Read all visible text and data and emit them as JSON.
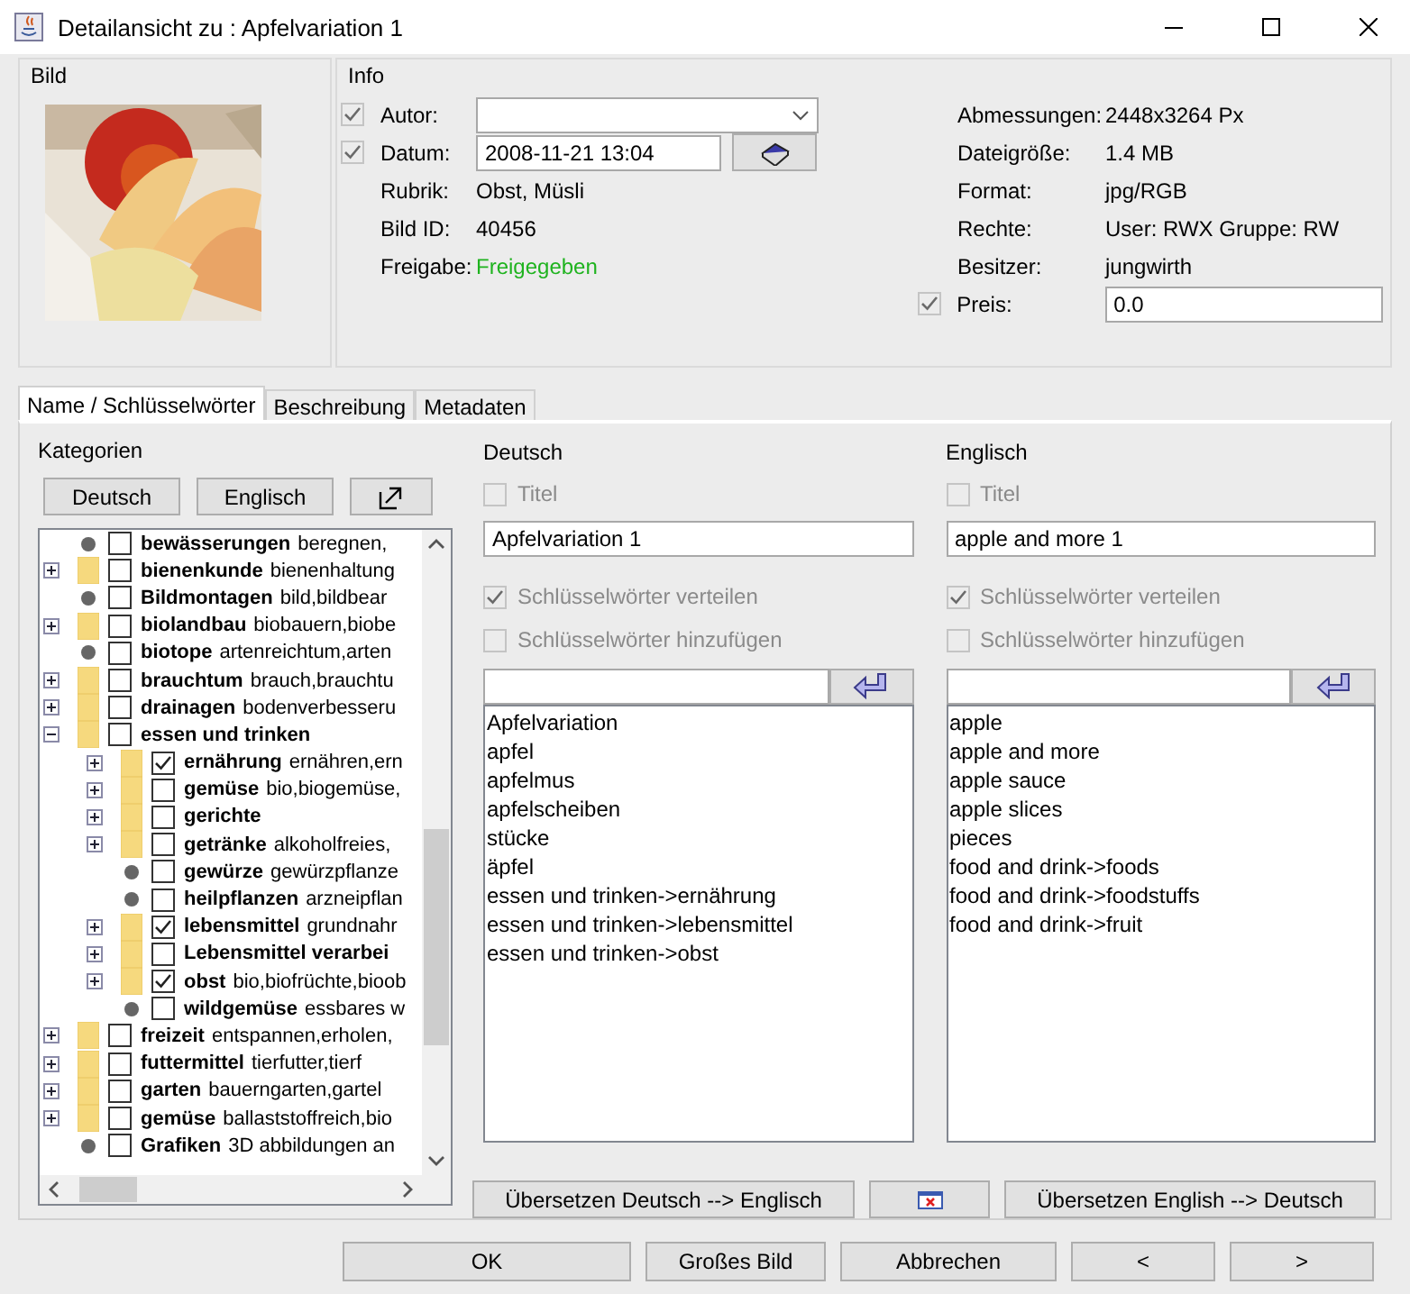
{
  "window": {
    "title": "Detailansicht zu : Apfelvariation 1"
  },
  "bild": {
    "title": "Bild"
  },
  "info": {
    "title": "Info",
    "left": [
      {
        "kind": "combo",
        "label": "Autor:",
        "checked": true,
        "disabled": true
      },
      {
        "kind": "date",
        "label": "Datum:",
        "checked": true,
        "disabled": true,
        "value": "2008-11-21 13:04"
      },
      {
        "kind": "text",
        "label": "Rubrik:",
        "value": "Obst, Müsli"
      },
      {
        "kind": "text",
        "label": "Bild ID:",
        "value": "40456"
      },
      {
        "kind": "text",
        "label": "Freigabe:",
        "value": "Freigegeben",
        "color": "#1fb31f"
      }
    ],
    "right": [
      {
        "kind": "text",
        "label": "Abmessungen:",
        "value": "2448x3264 Px"
      },
      {
        "kind": "text",
        "label": "Dateigröße:",
        "value": "1.4 MB"
      },
      {
        "kind": "text",
        "label": "Format:",
        "value": "jpg/RGB"
      },
      {
        "kind": "text",
        "label": "Rechte:",
        "value": "User: RWX Gruppe: RW"
      },
      {
        "kind": "text",
        "label": "Besitzer:",
        "value": "jungwirth"
      },
      {
        "kind": "input",
        "label": "Preis:",
        "checked": true,
        "disabled": true,
        "value": "0.0"
      }
    ]
  },
  "tabs": [
    {
      "label": "Name / Schlüsselwörter",
      "selected": true
    },
    {
      "label": "Beschreibung",
      "selected": false
    },
    {
      "label": "Metadaten",
      "selected": false
    }
  ],
  "categories": {
    "title": "Kategorien",
    "buttons": [
      "Deutsch",
      "Englisch"
    ],
    "tree": [
      {
        "kind": "leaf",
        "name": "bewässerungen",
        "keywords": "beregnen,",
        "checked": false
      },
      {
        "kind": "folder",
        "name": "bienenkunde",
        "keywords": "bienenhaltung",
        "checked": false,
        "expanded": false
      },
      {
        "kind": "leaf",
        "name": "Bildmontagen",
        "keywords": "bild,bildbear",
        "checked": false
      },
      {
        "kind": "folder",
        "name": "biolandbau",
        "keywords": "biobauern,biobe",
        "checked": false,
        "expanded": false
      },
      {
        "kind": "leaf",
        "name": "biotope",
        "keywords": "artenreichtum,arten",
        "checked": false
      },
      {
        "kind": "folder",
        "name": "brauchtum",
        "keywords": "brauch,brauchtu",
        "checked": false,
        "expanded": false
      },
      {
        "kind": "folder",
        "name": "drainagen",
        "keywords": "bodenverbesseru",
        "checked": false,
        "expanded": false
      },
      {
        "kind": "folder",
        "name": "essen und trinken",
        "checked": false,
        "expanded": true,
        "children": [
          {
            "kind": "folder",
            "name": "ernährung",
            "keywords": "ernähren,ern",
            "checked": true,
            "expanded": false
          },
          {
            "kind": "folder",
            "name": "gemüse",
            "keywords": "bio,biogemüse,",
            "checked": false,
            "expanded": false
          },
          {
            "kind": "folder",
            "name": "gerichte",
            "checked": false,
            "expanded": false
          },
          {
            "kind": "folder",
            "name": "getränke",
            "keywords": "alkoholfreies,",
            "checked": false,
            "expanded": false
          },
          {
            "kind": "leaf",
            "name": "gewürze",
            "keywords": "gewürzpflanze",
            "checked": false
          },
          {
            "kind": "leaf",
            "name": "heilpflanzen",
            "keywords": "arzneipflan",
            "checked": false
          },
          {
            "kind": "folder",
            "name": "lebensmittel",
            "keywords": "grundnahr",
            "checked": true,
            "expanded": false
          },
          {
            "kind": "folder",
            "name": "Lebensmittel verarbei",
            "checked": false,
            "expanded": false
          },
          {
            "kind": "folder",
            "name": "obst",
            "keywords": "bio,biofrüchte,bioob",
            "checked": true,
            "expanded": false
          },
          {
            "kind": "leaf",
            "name": "wildgemüse",
            "keywords": "essbares w",
            "checked": false
          }
        ]
      },
      {
        "kind": "folder",
        "name": "freizeit",
        "keywords": "entspannen,erholen,",
        "checked": false,
        "expanded": false
      },
      {
        "kind": "folder",
        "name": "futtermittel",
        "keywords": "tierfutter,tierf",
        "checked": false,
        "expanded": false
      },
      {
        "kind": "folder",
        "name": "garten",
        "keywords": "bauerngarten,gartel",
        "checked": false,
        "expanded": false
      },
      {
        "kind": "folder",
        "name": "gemüse",
        "keywords": "ballaststoffreich,bio",
        "checked": false,
        "expanded": false
      },
      {
        "kind": "leaf",
        "name": "Grafiken",
        "keywords": "3D abbildungen an",
        "checked": false
      }
    ]
  },
  "languages": [
    {
      "title": "Deutsch",
      "title_option": {
        "label": "Titel",
        "checked": false,
        "disabled": true
      },
      "title_value": "Apfelvariation 1",
      "options": [
        {
          "label": "Schlüsselwörter verteilen",
          "checked": true,
          "disabled": true
        },
        {
          "label": "Schlüsselwörter hinzufügen",
          "checked": false,
          "disabled": true
        }
      ],
      "keywords": [
        "Apfelvariation",
        "apfel",
        "apfelmus",
        "apfelscheiben",
        "stücke",
        "äpfel",
        "essen und trinken->ernährung",
        "essen und trinken->lebensmittel",
        "essen und trinken->obst"
      ]
    },
    {
      "title": "Englisch",
      "title_option": {
        "label": "Titel",
        "checked": false,
        "disabled": true
      },
      "title_value": "apple and more 1",
      "options": [
        {
          "label": "Schlüsselwörter verteilen",
          "checked": true,
          "disabled": true
        },
        {
          "label": "Schlüsselwörter hinzufügen",
          "checked": false,
          "disabled": true
        }
      ],
      "keywords": [
        "apple",
        "apple and more",
        "apple sauce",
        "apple slices",
        "pieces",
        "food and drink->foods",
        "food and drink->foodstuffs",
        "food and drink->fruit"
      ]
    }
  ],
  "translate_buttons": [
    "Übersetzen Deutsch --> Englisch",
    "Übersetzen English --> Deutsch"
  ],
  "buttons": [
    "OK",
    "Großes Bild",
    "Abbrechen",
    "<",
    ">"
  ]
}
